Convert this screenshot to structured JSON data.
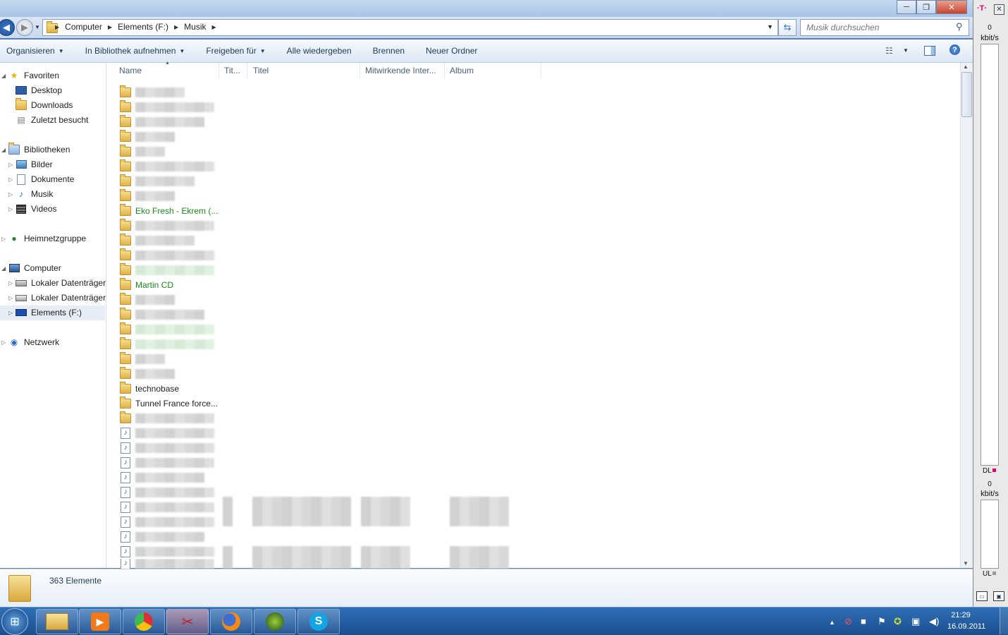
{
  "window": {
    "controls": {
      "minimize": "─",
      "maximize": "❐",
      "close": "✕"
    }
  },
  "address": {
    "crumbs": [
      "Computer",
      "Elements (F:)",
      "Musik"
    ],
    "search_placeholder": "Musik durchsuchen"
  },
  "toolbar": {
    "items": [
      "Organisieren",
      "In Bibliothek aufnehmen",
      "Freigeben für",
      "Alle wiedergeben",
      "Brennen",
      "Neuer Ordner"
    ]
  },
  "nav": {
    "favorites": "Favoriten",
    "desktop": "Desktop",
    "downloads": "Downloads",
    "recent": "Zuletzt besucht",
    "libraries": "Bibliotheken",
    "pictures": "Bilder",
    "documents": "Dokumente",
    "music": "Musik",
    "videos": "Videos",
    "homegroup": "Heimnetzgruppe",
    "computer": "Computer",
    "drive1": "Lokaler Datenträger",
    "drive2": "Lokaler Datenträger",
    "drive3": "Elements (F:)",
    "network": "Netzwerk"
  },
  "columns": {
    "name": "Name",
    "track": "Tit...",
    "title": "Titel",
    "artist": "Mitwirkende Inter...",
    "album": "Album"
  },
  "files": {
    "eko": "Eko Fresh - Ekrem (...",
    "martin": "Martin CD",
    "technobase": "technobase",
    "tunnel": "Tunnel France force..."
  },
  "details": {
    "count": "363 Elemente"
  },
  "gadget": {
    "dl_value": "0",
    "dl_unit": "kbit/s",
    "dl_label": "DL",
    "ul_value": "0",
    "ul_unit": "kbit/s",
    "ul_label": "UL"
  },
  "taskbar": {
    "time": "21:29",
    "date": "16.09.2011"
  }
}
